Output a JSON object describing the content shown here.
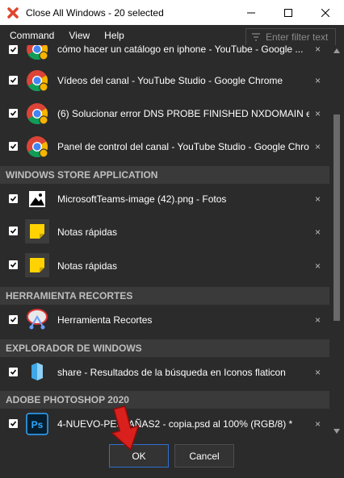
{
  "window": {
    "title": "Close All Windows - 20 selected",
    "minimize_label": "—",
    "maximize_label": "☐",
    "close_label": "✕"
  },
  "menu": {
    "items": [
      "Command",
      "View",
      "Help"
    ]
  },
  "filter": {
    "placeholder": "Enter filter text"
  },
  "rows": [
    {
      "label": "cómo hacer un catálogo en iphone - YouTube - Google ...",
      "icon": "chrome-icon",
      "checked": true
    },
    {
      "label": "Vídeos del canal - YouTube Studio - Google Chrome",
      "icon": "chrome-icon",
      "checked": true
    },
    {
      "label": "(6) Solucionar error DNS PROBE FINISHED NXDOMAIN e...",
      "icon": "chrome-icon",
      "checked": true
    },
    {
      "label": "Panel de control del canal - YouTube Studio - Google Chro",
      "icon": "chrome-icon",
      "checked": true
    },
    {
      "label": "MicrosoftTeams-image (42).png - Fotos",
      "icon": "photos-icon",
      "checked": true
    },
    {
      "label": "Notas rápidas",
      "icon": "sticky-notes-icon",
      "checked": true
    },
    {
      "label": "Notas rápidas",
      "icon": "sticky-notes-icon",
      "checked": true
    },
    {
      "label": "Herramienta Recortes",
      "icon": "snipping-tool-icon",
      "checked": true
    },
    {
      "label": "share - Resultados de la búsqueda en Iconos flaticon",
      "icon": "explorer-icon",
      "checked": true
    },
    {
      "label": "4-NUEVO-PESTAÑAS2 - copia.psd al 100% (RGB/8) *",
      "icon": "photoshop-icon",
      "checked": true
    }
  ],
  "groups": [
    "WINDOWS STORE APPLICATION",
    "HERRAMIENTA RECORTES",
    "EXPLORADOR DE WINDOWS",
    "ADOBE PHOTOSHOP 2020"
  ],
  "row_close_label": "×",
  "ps_icon_text": "Ps",
  "buttons": {
    "ok": "OK",
    "cancel": "Cancel"
  },
  "colors": {
    "background": "#2b2b2b",
    "group_header": "#3a3a3a",
    "ok_border": "#2f6fd0",
    "annotation_arrow": "#d9201c"
  }
}
